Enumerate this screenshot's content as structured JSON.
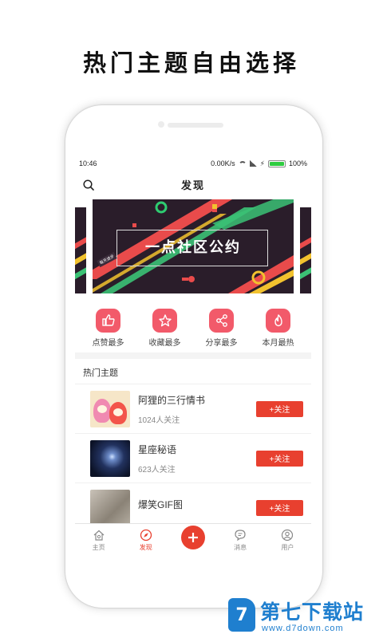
{
  "headline": "热门主题自由选择",
  "status": {
    "time": "10:46",
    "speed": "0.00K/s",
    "battery": "100%"
  },
  "header": {
    "title": "发现"
  },
  "banner": {
    "text": "一点社区公约",
    "sticker": "每天进步"
  },
  "actions": [
    {
      "label": "点赞最多",
      "icon": "thumbs-up-icon"
    },
    {
      "label": "收藏最多",
      "icon": "star-icon"
    },
    {
      "label": "分享最多",
      "icon": "share-icon"
    },
    {
      "label": "本月最热",
      "icon": "flame-icon"
    }
  ],
  "section": {
    "title": "热门主题"
  },
  "topics": [
    {
      "name": "阿狸的三行情书",
      "followers": "1024人关注",
      "button": "+关注"
    },
    {
      "name": "星座秘语",
      "followers": "623人关注",
      "button": "+关注"
    },
    {
      "name": "爆笑GIF图",
      "followers": "",
      "button": "+关注"
    }
  ],
  "tabbar": [
    {
      "label": "主页",
      "icon": "home-icon"
    },
    {
      "label": "发现",
      "icon": "compass-icon",
      "active": true
    },
    {
      "label": "",
      "icon": "plus-icon"
    },
    {
      "label": "消息",
      "icon": "chat-icon"
    },
    {
      "label": "用户",
      "icon": "user-icon"
    }
  ],
  "watermark": {
    "title": "第七下载站",
    "url": "www.d7down.com",
    "badge": "7"
  },
  "colors": {
    "accent": "#e8402f",
    "action_icon_bg": "#f25a6a",
    "watermark": "#1f7fcf"
  }
}
